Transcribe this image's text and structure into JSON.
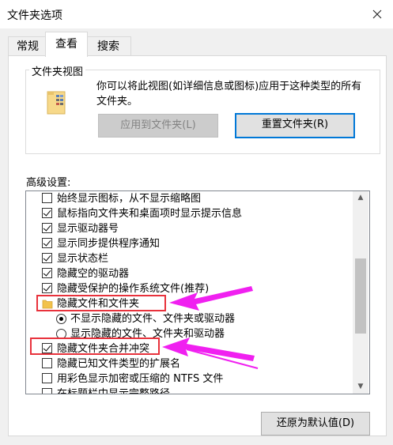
{
  "window": {
    "title": "文件夹选项",
    "close_glyph": "✕"
  },
  "tabs": [
    {
      "label": "常规",
      "active": false
    },
    {
      "label": "查看",
      "active": true
    },
    {
      "label": "搜索",
      "active": false
    }
  ],
  "folder_view": {
    "legend": "文件夹视图",
    "description": "你可以将此视图(如详细信息或图标)应用于这种类型的所有文件夹。",
    "apply_button": "应用到文件夹(L)",
    "reset_button": "重置文件夹(R)",
    "icon": "folder-icon"
  },
  "advanced": {
    "label": "高级设置:",
    "items": [
      {
        "type": "checkbox",
        "checked": false,
        "label": "始终显示图标，从不显示缩略图"
      },
      {
        "type": "checkbox",
        "checked": true,
        "label": "鼠标指向文件夹和桌面项时显示提示信息"
      },
      {
        "type": "checkbox",
        "checked": true,
        "label": "显示驱动器号"
      },
      {
        "type": "checkbox",
        "checked": true,
        "label": "显示同步提供程序通知"
      },
      {
        "type": "checkbox",
        "checked": true,
        "label": "显示状态栏"
      },
      {
        "type": "checkbox",
        "checked": true,
        "label": "隐藏空的驱动器"
      },
      {
        "type": "checkbox",
        "checked": true,
        "label": "隐藏受保护的操作系统文件(推荐)"
      },
      {
        "type": "folder",
        "label": "隐藏文件和文件夹"
      },
      {
        "type": "radio",
        "selected": true,
        "label": "不显示隐藏的文件、文件夹或驱动器"
      },
      {
        "type": "radio",
        "selected": false,
        "label": "显示隐藏的文件、文件夹和驱动器"
      },
      {
        "type": "checkbox",
        "checked": true,
        "label": "隐藏文件夹合并冲突"
      },
      {
        "type": "checkbox",
        "checked": false,
        "label": "隐藏已知文件类型的扩展名"
      },
      {
        "type": "checkbox",
        "checked": false,
        "label": "用彩色显示加密或压缩的 NTFS 文件"
      },
      {
        "type": "checkbox",
        "checked": false,
        "label": "在标题栏中显示完整路径"
      }
    ]
  },
  "restore_button": "还原为默认值(D)",
  "colors": {
    "annotation_red": "#e8323c",
    "arrow_magenta": "#f020f0",
    "focus_blue": "#0078d7"
  }
}
